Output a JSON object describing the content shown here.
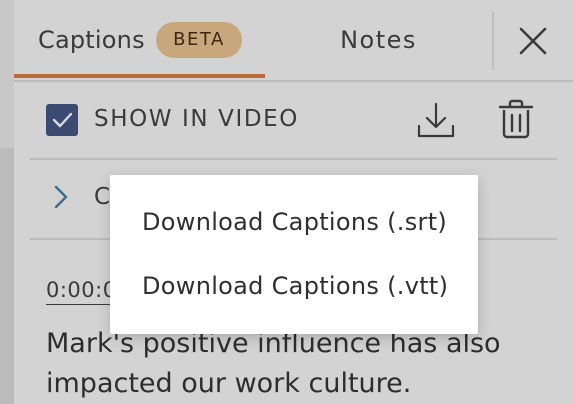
{
  "tabs": {
    "captions_label": "Captions",
    "beta_badge": "BETA",
    "notes_label": "Notes"
  },
  "toolbar": {
    "show_in_video_label": "SHOW IN VIDEO",
    "show_in_video_checked": true
  },
  "section": {
    "label_visible_fragment": "C"
  },
  "caption": {
    "timestamp": "0:00:0",
    "text": "Mark's positive influence has also impacted our work culture."
  },
  "download_menu": {
    "items": [
      {
        "label": "Download Captions (.srt)"
      },
      {
        "label": "Download Captions (.vtt)"
      }
    ]
  },
  "icons": {
    "close": "close-icon",
    "checkbox": "checkmark-icon",
    "download": "download-icon",
    "trash": "trash-icon",
    "chevron": "chevron-right-icon"
  },
  "colors": {
    "accent_underline": "#bf6a3a",
    "beta_badge_bg": "#c8a77c",
    "checkbox_bg": "#3b4a72",
    "chevron": "#3d6e88"
  }
}
